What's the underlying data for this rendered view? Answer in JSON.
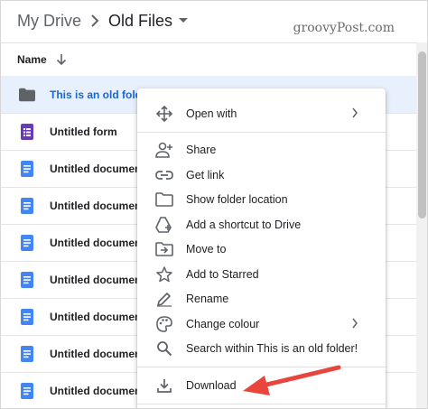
{
  "breadcrumb": {
    "root": "My Drive",
    "current": "Old Files"
  },
  "watermark": "groovyPost.com",
  "list_header": {
    "name_label": "Name"
  },
  "files": [
    {
      "name": "This is an old folder",
      "icon": "folder-icon",
      "selected": true
    },
    {
      "name": "Untitled form",
      "icon": "form-icon",
      "selected": false
    },
    {
      "name": "Untitled document",
      "icon": "document-icon",
      "selected": false
    },
    {
      "name": "Untitled document",
      "icon": "document-icon",
      "selected": false
    },
    {
      "name": "Untitled document",
      "icon": "document-icon",
      "selected": false
    },
    {
      "name": "Untitled document",
      "icon": "document-icon",
      "selected": false
    },
    {
      "name": "Untitled document",
      "icon": "document-icon",
      "selected": false
    },
    {
      "name": "Untitled document",
      "icon": "document-icon",
      "selected": false
    },
    {
      "name": "Untitled document",
      "icon": "document-icon",
      "selected": false
    }
  ],
  "context_menu": {
    "open_with": "Open with",
    "share": "Share",
    "get_link": "Get link",
    "show_folder_location": "Show folder location",
    "add_shortcut": "Add a shortcut to Drive",
    "move_to": "Move to",
    "add_starred": "Add to Starred",
    "rename": "Rename",
    "change_colour": "Change colour",
    "search_within": "Search within This is an old folder!",
    "download": "Download"
  },
  "colors": {
    "selected_row": "#e8f0fe",
    "selected_text": "#1967d2",
    "doc_blue": "#4285f4",
    "form_purple": "#673ab7",
    "annotation_red": "#e8453c"
  }
}
